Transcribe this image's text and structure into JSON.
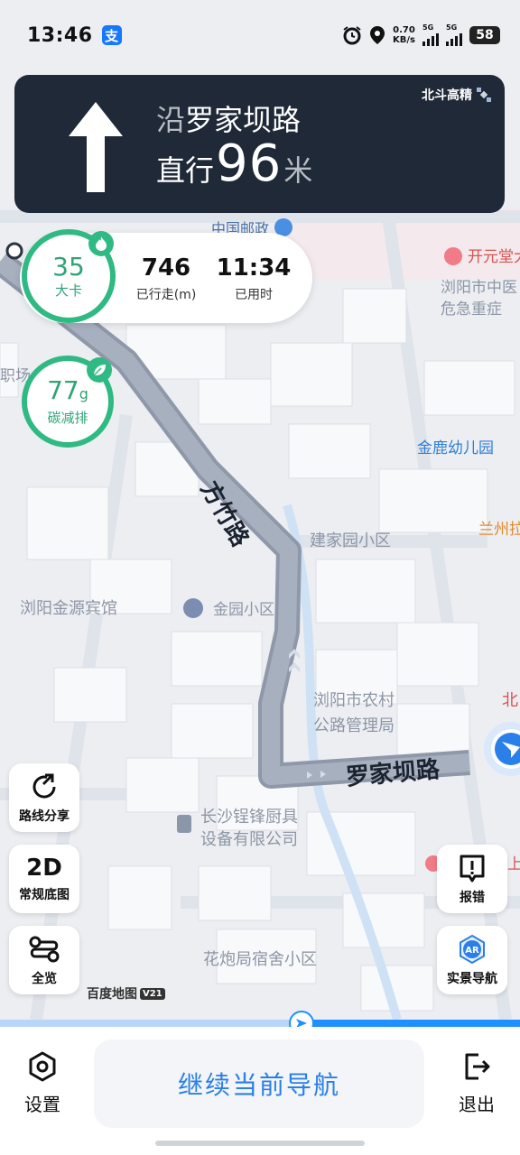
{
  "status_bar": {
    "time": "13:46",
    "app_badge": "支",
    "net_speed_value": "0.70",
    "net_speed_unit": "KB/s",
    "sim1_label": "5G",
    "sim2_label": "5G",
    "battery": "58"
  },
  "guidance": {
    "road_prefix": "沿",
    "road_name": "罗家坝路",
    "action": "直行",
    "distance": "96",
    "unit": "米",
    "positioning": "北斗高精"
  },
  "trip_stats": {
    "calories_value": "35",
    "calories_unit": "大卡",
    "distance_value": "746",
    "distance_label": "已行走(m)",
    "time_value": "11:34",
    "time_label": "已用时"
  },
  "carbon": {
    "value": "77",
    "unit": "g",
    "label": "碳减排"
  },
  "map": {
    "labels": {
      "post_office": "中国邮政",
      "kaiyuan": "开元堂大",
      "hospital_1": "浏阳市中医",
      "hospital_2": "危急重症",
      "job_market": "职场",
      "kindergarten": "金鹿幼儿园",
      "route_road": "方竹路",
      "jianjia": "建家园小区",
      "lanzhou": "兰州拉",
      "hotel": "浏阳金源宾馆",
      "jinyuan": "金园小区",
      "transport_1": "浏阳市农村",
      "transport_2": "公路管理局",
      "current_road": "罗家坝路",
      "beijing_partial": "北",
      "company_1": "长沙锃锋厨具",
      "company_2": "设备有限公司",
      "dormitory": "花炮局宿舍小区",
      "partial_east": "上"
    }
  },
  "side_buttons": {
    "share_route": "路线分享",
    "map_mode_title": "2D",
    "map_mode_label": "常规底图",
    "overview": "全览",
    "report": "报错",
    "ar_badge": "AR",
    "ar_nav": "实景导航"
  },
  "brand": {
    "name": "百度地图",
    "version": "V21"
  },
  "progress": {
    "fraction_remaining": 0.42
  },
  "bottom_bar": {
    "settings": "设置",
    "continue": "继续当前导航",
    "exit": "退出"
  },
  "colors": {
    "panel_dark": "#1f2937",
    "eco_green": "#2fb983",
    "accent_blue": "#2a7fe8",
    "route_gray": "#8e98a8"
  }
}
